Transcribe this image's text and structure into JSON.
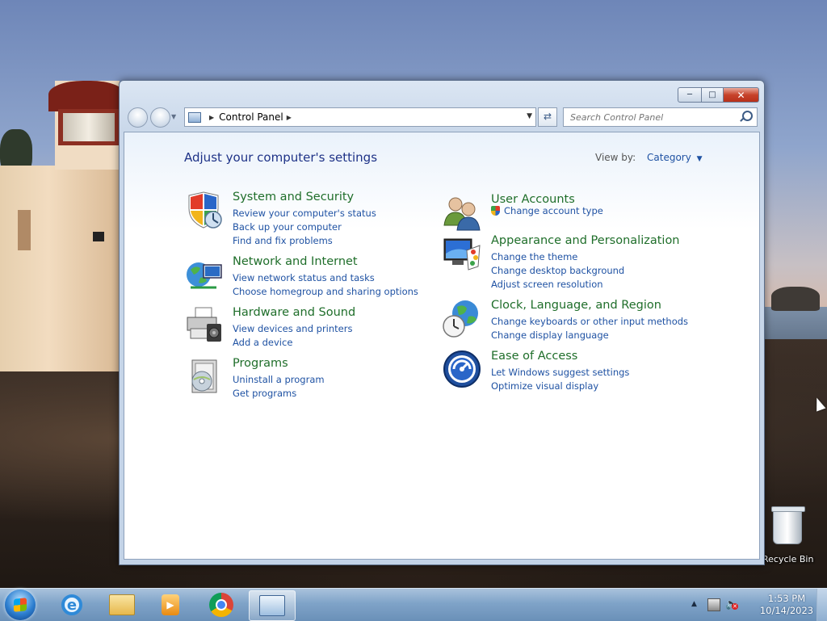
{
  "window": {
    "breadcrumb": [
      "Control Panel"
    ],
    "search_placeholder": "Search Control Panel",
    "heading": "Adjust your computer's settings",
    "view_by_label": "View by:",
    "view_by_value": "Category"
  },
  "categories": [
    {
      "title": "System and Security",
      "links": [
        "Review your computer's status",
        "Back up your computer",
        "Find and fix problems"
      ],
      "icon": "shield-icon"
    },
    {
      "title": "Network and Internet",
      "links": [
        "View network status and tasks",
        "Choose homegroup and sharing options"
      ],
      "icon": "globe-network-icon"
    },
    {
      "title": "Hardware and Sound",
      "links": [
        "View devices and printers",
        "Add a device"
      ],
      "icon": "printer-icon"
    },
    {
      "title": "Programs",
      "links": [
        "Uninstall a program",
        "Get programs"
      ],
      "icon": "programs-icon"
    },
    {
      "title": "User Accounts",
      "links": [
        "Change account type"
      ],
      "icon": "users-icon"
    },
    {
      "title": "Appearance and Personalization",
      "links": [
        "Change the theme",
        "Change desktop background",
        "Adjust screen resolution"
      ],
      "icon": "monitor-palette-icon"
    },
    {
      "title": "Clock, Language, and Region",
      "links": [
        "Change keyboards or other input methods",
        "Change display language"
      ],
      "icon": "clock-globe-icon"
    },
    {
      "title": "Ease of Access",
      "links": [
        "Let Windows suggest settings",
        "Optimize visual display"
      ],
      "icon": "ease-of-access-icon"
    }
  ],
  "desktop": {
    "recycle_bin_label": "Recycle Bin"
  },
  "taskbar": {
    "time": "1:53 PM",
    "date": "10/14/2023",
    "pinned": [
      "internet-explorer-icon",
      "windows-explorer-icon",
      "media-player-icon",
      "chrome-icon",
      "control-panel-icon"
    ]
  },
  "colors": {
    "link": "#1f52a3",
    "category_title": "#1f6e2a",
    "heading": "#1e3287"
  }
}
